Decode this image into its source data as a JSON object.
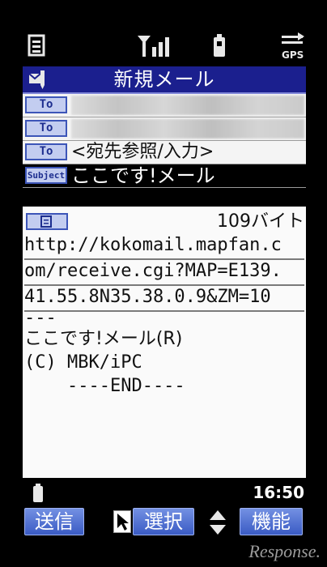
{
  "status_bar": {
    "icons": [
      "memo-icon",
      "signal-icon",
      "battery-icon",
      "gps-icon"
    ],
    "gps_label": "GPS"
  },
  "title_bar": {
    "title": "新規メール",
    "icon": "mail-edit-icon"
  },
  "fields": [
    {
      "label": "To",
      "value": "",
      "selected": false
    },
    {
      "label": "To",
      "value": "",
      "selected": false
    },
    {
      "label": "To",
      "value": "<宛先参照/入力>",
      "selected": false
    },
    {
      "label": "Subject",
      "value": "ここです!メール",
      "selected": true
    }
  ],
  "body": {
    "size_label": "109バイト",
    "lines": [
      "http://kokomail.mapfan.c",
      "om/receive.cgi?MAP=E139.",
      "41.55.8N35.38.0.9&ZM=10",
      "---",
      "ここです!メール(R)",
      "(C) MBK/iPC",
      "    ----END----"
    ]
  },
  "bottom_status": {
    "time": "16:50"
  },
  "softkeys": {
    "left": "送信",
    "center": "選択",
    "right": "機能"
  },
  "watermark": "Response."
}
